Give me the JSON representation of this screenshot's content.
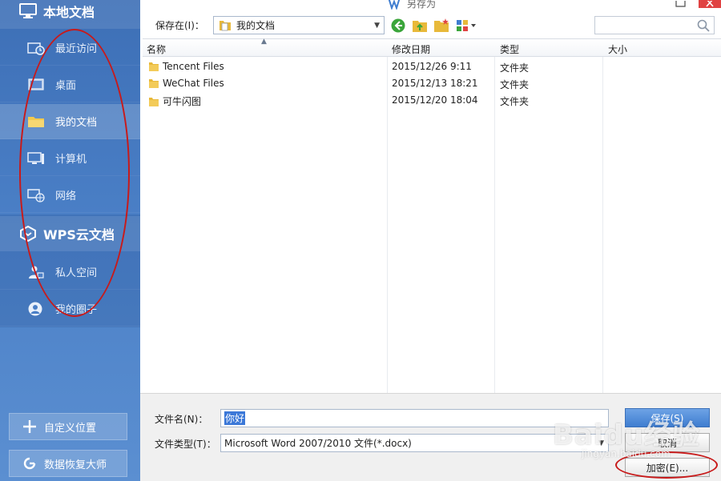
{
  "window": {
    "title": "另存为"
  },
  "colors": {
    "sidebar": "#4a7fc6",
    "accent": "#3f7dd0",
    "annotation": "#c81a1a",
    "close": "#e04343"
  },
  "sidebar": {
    "local_heading": "本地文档",
    "local_icon": "monitor-icon",
    "local_items": [
      {
        "label": "最近访问",
        "icon": "recent-icon"
      },
      {
        "label": "桌面",
        "icon": "desktop-icon"
      },
      {
        "label": "我的文档",
        "icon": "folder-icon",
        "active": true
      },
      {
        "label": "计算机",
        "icon": "computer-icon"
      },
      {
        "label": "网络",
        "icon": "network-icon"
      }
    ],
    "cloud_heading": "WPS云文档",
    "cloud_icon": "wps-cloud-icon",
    "cloud_items": [
      {
        "label": "私人空间",
        "icon": "private-space-icon"
      },
      {
        "label": "我的圈子",
        "icon": "user-circle-icon"
      }
    ],
    "custom_location_label": "自定义位置",
    "custom_location_icon": "plus-icon",
    "recovery_label": "数据恢复大师",
    "recovery_icon": "recovery-icon"
  },
  "toolbar": {
    "save_in_label": "保存在(I)：",
    "save_in_value": "我的文档",
    "tools": [
      "back-arrow-icon",
      "up-folder-icon",
      "new-folder-icon",
      "view-mode-icon"
    ]
  },
  "list": {
    "columns": [
      "名称",
      "修改日期",
      "类型",
      "大小"
    ],
    "rows": [
      {
        "name": "Tencent Files",
        "date": "2015/12/26 9:11",
        "type": "文件夹",
        "size": ""
      },
      {
        "name": "WeChat Files",
        "date": "2015/12/13 18:21",
        "type": "文件夹",
        "size": ""
      },
      {
        "name": "可牛闪图",
        "date": "2015/12/20 18:04",
        "type": "文件夹",
        "size": ""
      }
    ]
  },
  "bottom": {
    "filename_label": "文件名(N)：",
    "filename_value": "你好",
    "filetype_label": "文件类型(T)：",
    "filetype_value": "Microsoft Word 2007/2010 文件(*.docx)",
    "save_button": "保存(S)",
    "cancel_button": "取消",
    "encrypt_button": "加密(E)..."
  },
  "watermark": {
    "main": "Baidu经验",
    "sub": "jingyan.baidu.com"
  }
}
